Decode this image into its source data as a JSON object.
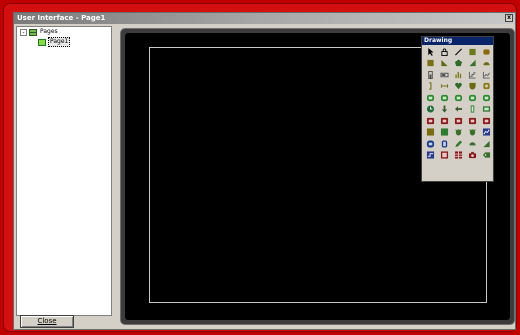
{
  "window": {
    "title": "User Interface - Page1",
    "close_glyph": "x"
  },
  "tree": {
    "root": {
      "label": "Pages",
      "expander": "-",
      "icon": "pages-icon"
    },
    "children": [
      {
        "label": "Page1",
        "icon": "page-icon",
        "selected": true
      }
    ]
  },
  "footer": {
    "close_label": "Close"
  },
  "palette": {
    "title": "Drawing",
    "tools": [
      {
        "name": "pointer-tool",
        "icon": "arrow-pointer-icon",
        "color": "#000000",
        "bg": "none"
      },
      {
        "name": "lock-tool",
        "icon": "lock-icon",
        "color": "#000000",
        "bg": "none"
      },
      {
        "name": "line-tool",
        "icon": "line-icon",
        "color": "#000000",
        "bg": "none"
      },
      {
        "name": "rectangle-tool",
        "icon": "rectangle-icon",
        "color": "#6b7a1f",
        "bg": "#6b7a1f"
      },
      {
        "name": "rounded-rectangle-tool",
        "icon": "rounded-rectangle-icon",
        "color": "#8a6a10",
        "bg": "#8a6a10"
      },
      {
        "name": "square-tool",
        "icon": "square-icon",
        "color": "#7c6f1a",
        "bg": "#7c6f1a"
      },
      {
        "name": "triangle-tool",
        "icon": "triangle-icon",
        "color": "#5a6b1c",
        "bg": "#5a6b1c"
      },
      {
        "name": "polygon-tool",
        "icon": "polygon-icon",
        "color": "#2f6b2a",
        "bg": "#2f6b2a"
      },
      {
        "name": "shape-tool",
        "icon": "wedge-icon",
        "color": "#3a6e2a",
        "bg": "#3a6e2a"
      },
      {
        "name": "arc-tool",
        "icon": "arc-icon",
        "color": "#6b6b10",
        "bg": "#6b6b10"
      },
      {
        "name": "meter-tool",
        "icon": "meter-icon",
        "color": "#4a4a4a",
        "bg": "none"
      },
      {
        "name": "gauge-tool",
        "icon": "gauge-icon",
        "color": "#4a4a4a",
        "bg": "none"
      },
      {
        "name": "bar-chart-tool",
        "icon": "bar-chart-icon",
        "color": "#7a7a20",
        "bg": "none"
      },
      {
        "name": "stepped-chart-tool",
        "icon": "stepped-chart-icon",
        "color": "#5a5a5a",
        "bg": "none"
      },
      {
        "name": "line-chart-tool",
        "icon": "line-chart-icon",
        "color": "#5a5a5a",
        "bg": "none"
      },
      {
        "name": "bracket-tool",
        "icon": "bracket-icon",
        "color": "#6b6b10",
        "bg": "none"
      },
      {
        "name": "dimension-tool",
        "icon": "dimension-icon",
        "color": "#6b6b10",
        "bg": "none"
      },
      {
        "name": "heart-tool",
        "icon": "heart-icon",
        "color": "#2f6b2a",
        "bg": "#2f6b2a"
      },
      {
        "name": "shield-tool",
        "icon": "shield-icon",
        "color": "#6b6b10",
        "bg": "#6b6b10"
      },
      {
        "name": "badge-tool",
        "icon": "badge-icon",
        "color": "#8a7a10",
        "bg": "#8a7a10"
      },
      {
        "name": "indicator-a-tool",
        "icon": "indicator-icon",
        "color": "#2e8a2e",
        "bg": "#2e8a2e"
      },
      {
        "name": "indicator-b-tool",
        "icon": "indicator-icon",
        "color": "#2e8a2e",
        "bg": "#2e8a2e"
      },
      {
        "name": "indicator-c-tool",
        "icon": "indicator-icon",
        "color": "#2e8a2e",
        "bg": "#2e8a2e"
      },
      {
        "name": "indicator-d-tool",
        "icon": "indicator-icon",
        "color": "#2e8a2e",
        "bg": "#2e8a2e"
      },
      {
        "name": "indicator-e-tool",
        "icon": "indicator-icon",
        "color": "#2e8a2e",
        "bg": "#2e8a2e"
      },
      {
        "name": "clock-tool",
        "icon": "clock-icon",
        "color": "#1f6b3a",
        "bg": "#1f6b3a"
      },
      {
        "name": "down-arrow-tool",
        "icon": "down-arrow-icon",
        "color": "#3a5a2a",
        "bg": "none"
      },
      {
        "name": "left-arrow-tool",
        "icon": "left-arrow-icon",
        "color": "#3a5a2a",
        "bg": "none"
      },
      {
        "name": "column-tool",
        "icon": "column-icon",
        "color": "#2e7a2e",
        "bg": "#2e7a2e"
      },
      {
        "name": "panel-tool",
        "icon": "panel-icon",
        "color": "#2e7a2e",
        "bg": "#2e7a2e"
      },
      {
        "name": "button-a-tool",
        "icon": "button-icon",
        "color": "#8a1a1a",
        "bg": "#8a1a1a"
      },
      {
        "name": "button-b-tool",
        "icon": "button-icon",
        "color": "#8a1a1a",
        "bg": "#8a1a1a"
      },
      {
        "name": "button-c-tool",
        "icon": "button-icon",
        "color": "#8a1a1a",
        "bg": "#8a1a1a"
      },
      {
        "name": "button-d-tool",
        "icon": "button-icon",
        "color": "#8a1a1a",
        "bg": "#8a1a1a"
      },
      {
        "name": "button-e-tool",
        "icon": "button-icon",
        "color": "#8a1a1a",
        "bg": "#8a1a1a"
      },
      {
        "name": "block-a-tool",
        "icon": "block-icon",
        "color": "#7a6a10",
        "bg": "#7a6a10"
      },
      {
        "name": "block-b-tool",
        "icon": "block-icon",
        "color": "#2e7a2e",
        "bg": "#2e7a2e"
      },
      {
        "name": "bug-a-tool",
        "icon": "bug-icon",
        "color": "#3a6e2a",
        "bg": "none"
      },
      {
        "name": "bug-b-tool",
        "icon": "bug-icon",
        "color": "#3a6e2a",
        "bg": "none"
      },
      {
        "name": "graph-tool",
        "icon": "graph-icon",
        "color": "#2a3a8a",
        "bg": "#2a3a8a"
      },
      {
        "name": "numeric-tool",
        "icon": "numeric-icon",
        "color": "#1a3a8a",
        "bg": "#1a3a8a"
      },
      {
        "name": "digit-tool",
        "icon": "digit-icon",
        "color": "#1a3a8a",
        "bg": "#1a3a8a"
      },
      {
        "name": "edit-tool",
        "icon": "pencil-icon",
        "color": "#2e7a2e",
        "bg": "none"
      },
      {
        "name": "half-circle-tool",
        "icon": "half-circle-icon",
        "color": "#3a6e2a",
        "bg": "#3a6e2a"
      },
      {
        "name": "wedge-tool",
        "icon": "wedge-icon",
        "color": "#3a6e2a",
        "bg": "#3a6e2a"
      },
      {
        "name": "trend-tool",
        "icon": "trend-icon",
        "color": "#2a3a8a",
        "bg": "#2a3a8a"
      },
      {
        "name": "alarm-tool",
        "icon": "alarm-icon",
        "color": "#8a1a1a",
        "bg": "#8a1a1a"
      },
      {
        "name": "table-tool",
        "icon": "table-icon",
        "color": "#8a1a1a",
        "bg": "#8a1a1a"
      },
      {
        "name": "camera-tool",
        "icon": "camera-icon",
        "color": "#8a1a1a",
        "bg": "none"
      },
      {
        "name": "tag-tool",
        "icon": "tag-icon",
        "color": "#3a6e2a",
        "bg": "#3a6e2a"
      }
    ]
  },
  "colors": {
    "frame": "#d40f0f",
    "canvas": "#000000",
    "page_outline": "#c8c8c8",
    "palette_title": "#0a246a"
  }
}
